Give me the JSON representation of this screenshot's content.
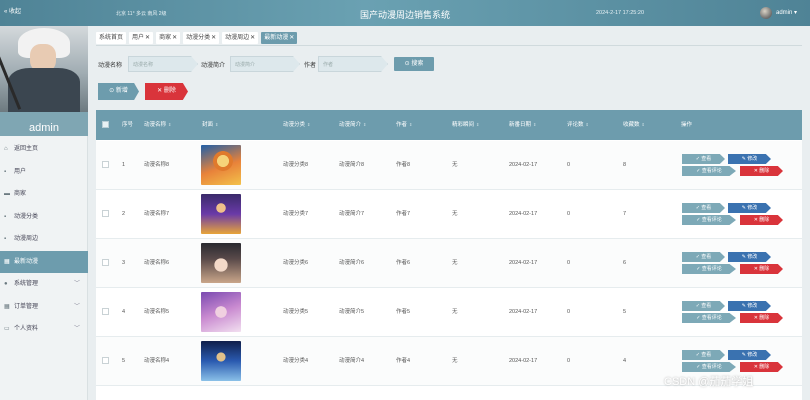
{
  "topbar": {
    "collapse_label": "« 收起",
    "weather": "北京  11°  多云  南风  2级",
    "title": "国产动漫周边销售系统",
    "datetime": "2024-2-17 17:25:20",
    "username": "admin ▾"
  },
  "sidebar": {
    "admin_label": "admin",
    "items": [
      {
        "label": "返回主页",
        "icon": "home-icon",
        "glyph": "⌂",
        "arrow": ""
      },
      {
        "label": "用户",
        "icon": "grid-icon",
        "glyph": "▪",
        "arrow": ""
      },
      {
        "label": "商家",
        "icon": "shop-icon",
        "glyph": "▬",
        "arrow": ""
      },
      {
        "label": "动漫分类",
        "icon": "category-icon",
        "glyph": "▪",
        "arrow": ""
      },
      {
        "label": "动漫周边",
        "icon": "goods-icon",
        "glyph": "▪",
        "arrow": ""
      },
      {
        "label": "最新动漫",
        "icon": "list-icon",
        "glyph": "▦",
        "arrow": ""
      },
      {
        "label": "系统管理",
        "icon": "settings-icon",
        "glyph": "●",
        "arrow": "﹀"
      },
      {
        "label": "订单管理",
        "icon": "order-icon",
        "glyph": "▦",
        "arrow": "﹀"
      },
      {
        "label": "个人资料",
        "icon": "profile-icon",
        "glyph": "▭",
        "arrow": "﹀"
      }
    ]
  },
  "tabs": [
    {
      "label": "系统首页",
      "x": ""
    },
    {
      "label": "用户",
      "x": "✕"
    },
    {
      "label": "商家",
      "x": "✕"
    },
    {
      "label": "动漫分类",
      "x": "✕"
    },
    {
      "label": "动漫周边",
      "x": "✕"
    },
    {
      "label": "最新动漫",
      "x": "✕"
    }
  ],
  "search": {
    "name_label": "动漫名称",
    "name_placeholder": "动漫名称",
    "intro_label": "动漫简介",
    "intro_placeholder": "动漫简介",
    "author_label": "作者",
    "author_placeholder": "作者",
    "button_label": "⊙ 搜索"
  },
  "actions": {
    "add_label": "⊙ 新增",
    "delete_label": "✕ 删除"
  },
  "table": {
    "headers": [
      "序号",
      "动漫名称",
      "封面",
      "动漫分类",
      "动漫简介",
      "作者",
      "精彩瞬间",
      "新番日期",
      "评论数",
      "收藏数",
      "操作"
    ],
    "sort_mark": "⇕",
    "row_buttons": {
      "view": "✓ 查看",
      "edit": "✎ 修改",
      "comment": "✓ 查看评论",
      "delete": "✕ 删除"
    },
    "rows": [
      {
        "idx": "1",
        "name": "动漫名称8",
        "category": "动漫分类8",
        "intro": "动漫简介8",
        "author": "作者8",
        "moment": "无",
        "date": "2024-02-17",
        "comments": "0",
        "favs": "8"
      },
      {
        "idx": "2",
        "name": "动漫名称7",
        "category": "动漫分类7",
        "intro": "动漫简介7",
        "author": "作者7",
        "moment": "无",
        "date": "2024-02-17",
        "comments": "0",
        "favs": "7"
      },
      {
        "idx": "3",
        "name": "动漫名称6",
        "category": "动漫分类6",
        "intro": "动漫简介6",
        "author": "作者6",
        "moment": "无",
        "date": "2024-02-17",
        "comments": "0",
        "favs": "6"
      },
      {
        "idx": "4",
        "name": "动漫名称5",
        "category": "动漫分类5",
        "intro": "动漫简介5",
        "author": "作者5",
        "moment": "无",
        "date": "2024-02-17",
        "comments": "0",
        "favs": "5"
      },
      {
        "idx": "5",
        "name": "动漫名称4",
        "category": "动漫分类4",
        "intro": "动漫简介4",
        "author": "作者4",
        "moment": "无",
        "date": "2024-02-17",
        "comments": "0",
        "favs": "4"
      }
    ]
  },
  "watermark": "CSDN @茄茄学姐",
  "colors": {
    "accent": "#6d9cad",
    "danger": "#d9343b",
    "edit": "#3a72b0"
  }
}
